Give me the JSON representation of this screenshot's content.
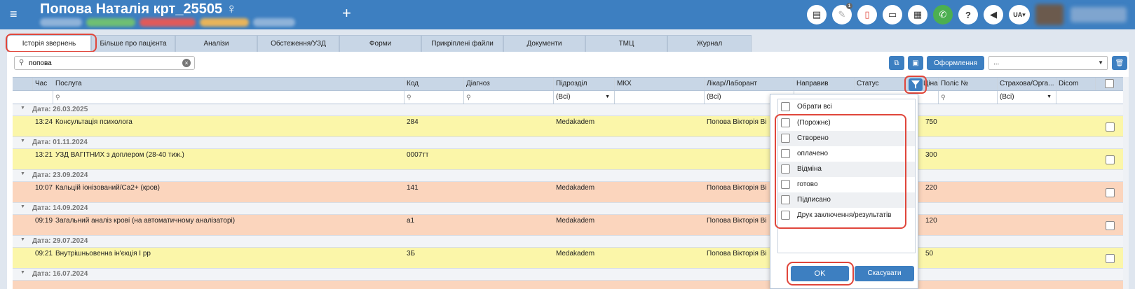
{
  "header": {
    "menu_icon": "hamburger-icon",
    "patient_name": "Попова Наталія крт_25505 ♀",
    "add_icon": "plus-icon",
    "language": "UA",
    "icons": [
      "chat-icon",
      "pen-icon",
      "pdf-icon",
      "card-icon",
      "calculator-icon",
      "phone-icon",
      "help-icon",
      "megaphone-icon"
    ],
    "notification_count": "1"
  },
  "tabs": [
    {
      "label": "Історія звернень"
    },
    {
      "label": "Більше про пацієнта"
    },
    {
      "label": "Аналізи"
    },
    {
      "label": "Обстеження/УЗД"
    },
    {
      "label": "Форми"
    },
    {
      "label": "Прикріплені файли"
    },
    {
      "label": "Документи"
    },
    {
      "label": "ТМЦ"
    },
    {
      "label": "Журнал"
    }
  ],
  "toolbar": {
    "search_value": "попова",
    "format_button": "Оформлення",
    "select_value": "..."
  },
  "grid": {
    "columns": [
      "Час",
      "Послуга",
      "Код",
      "Діагноз",
      "Підрозділ",
      "МКХ",
      "Лікар/Лаборант",
      "Направив",
      "Статус",
      "Ціна",
      "Поліс №",
      "Страхова/Орга...",
      "Dicom"
    ],
    "filter_all": "(Всі)",
    "groups": [
      {
        "date": "Дата: 26.03.2025",
        "row": {
          "time": "13:24",
          "service": "Консультація психолога",
          "code": "284",
          "unit": "Medakadem",
          "doctor": "Попова Вікторія Ві",
          "price": "750",
          "color": "yellow"
        }
      },
      {
        "date": "Дата: 01.11.2024",
        "row": {
          "time": "13:21",
          "service": "УЗД ВАГІТНИХ з доплером (28-40 тиж.)",
          "code": "0007тт",
          "unit": "",
          "doctor": "",
          "price": "300",
          "color": "yellow"
        }
      },
      {
        "date": "Дата: 23.09.2024",
        "row": {
          "time": "10:07",
          "service": "Кальцій іонізований/Ca2+ (кров)",
          "code": "141",
          "unit": "Medakadem",
          "doctor": "Попова Вікторія Ві",
          "price": "220",
          "color": "orange"
        }
      },
      {
        "date": "Дата: 14.09.2024",
        "row": {
          "time": "09:19",
          "service": "Загальний аналіз крові (на автоматичному аналізаторі)",
          "code": "a1",
          "unit": "Medakadem",
          "doctor": "Попова Вікторія Ві",
          "price": "120",
          "color": "orange"
        }
      },
      {
        "date": "Дата: 29.07.2024",
        "row": {
          "time": "09:21",
          "service": "Внутрішньовенна ін'єкція І рр",
          "code": "3Б",
          "unit": "Medakadem",
          "doctor": "Попова Вікторія Ві",
          "price": "50",
          "color": "yellow"
        }
      },
      {
        "date": "Дата: 16.07.2024",
        "row": null
      }
    ]
  },
  "status_filter": {
    "select_all": "Обрати всі",
    "options": [
      "(Порожнє)",
      "Створено",
      "оплачено",
      "Відміна",
      "готово",
      "Підписано",
      "Друк заключення/результатів"
    ],
    "ok": "OK",
    "cancel": "Скасувати"
  }
}
